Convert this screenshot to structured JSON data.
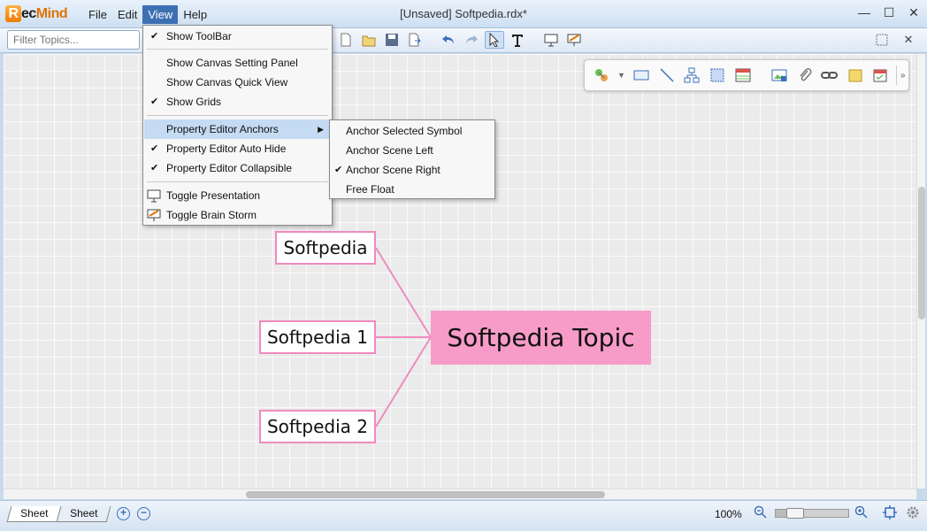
{
  "app": {
    "logo_r": "R",
    "logo_ec": "ec",
    "logo_mind": "Mind",
    "window_title": "[Unsaved] Softpedia.rdx*"
  },
  "menu": {
    "file": "File",
    "edit": "Edit",
    "view": "View",
    "help": "Help"
  },
  "window_controls": {
    "minimize": "—",
    "maximize": "☐",
    "close": "✕"
  },
  "filter": {
    "placeholder": "Filter Topics..."
  },
  "view_menu": {
    "items": [
      {
        "label": "Show ToolBar",
        "checked": "✔"
      },
      {
        "label": "Show Canvas Setting Panel"
      },
      {
        "label": "Show Canvas Quick View"
      },
      {
        "label": "Show Grids",
        "checked": "✔"
      },
      {
        "label": "Property Editor Anchors",
        "arrow": "▶"
      },
      {
        "label": "Property Editor Auto Hide",
        "checked": "✔"
      },
      {
        "label": "Property Editor Collapsible",
        "checked": "✔"
      },
      {
        "label": "Toggle Presentation"
      },
      {
        "label": "Toggle Brain Storm"
      }
    ]
  },
  "anchors_submenu": {
    "items": [
      {
        "label": "Anchor Selected Symbol"
      },
      {
        "label": "Anchor Scene Left"
      },
      {
        "label": "Anchor Scene Right",
        "checked": "✔"
      },
      {
        "label": "Free Float"
      }
    ]
  },
  "mindmap": {
    "central": "Softpedia Topic",
    "topics": [
      "Softpedia",
      "Softpedia 1",
      "Softpedia 2"
    ],
    "link_color": "#f08bbf",
    "central_color": "#f79bc8"
  },
  "statusbar": {
    "sheet1": "Sheet",
    "sheet2": "Sheet",
    "add": "+",
    "remove": "−",
    "zoom": "100%",
    "zoom_level": 0.2
  }
}
